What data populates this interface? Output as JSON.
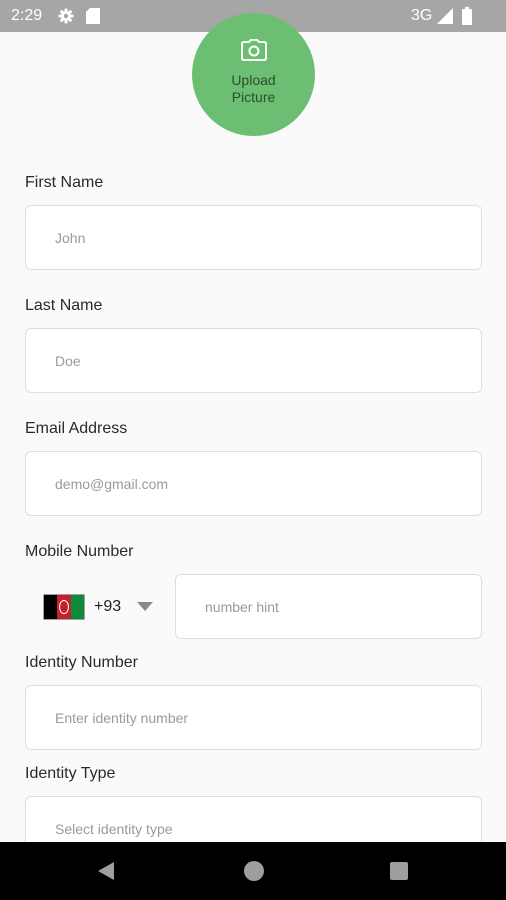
{
  "status_bar": {
    "time": "2:29",
    "network": "3G",
    "icons": [
      "gear-icon",
      "sd-card-icon",
      "signal-icon",
      "battery-icon"
    ]
  },
  "upload": {
    "line1": "Upload",
    "line2": "Picture",
    "icon": "camera-icon",
    "color": "#6cbf72"
  },
  "form": {
    "first_name": {
      "label": "First Name",
      "placeholder": "John"
    },
    "last_name": {
      "label": "Last Name",
      "placeholder": "Doe"
    },
    "email": {
      "label": "Email Address",
      "placeholder": "demo@gmail.com"
    },
    "mobile": {
      "label": "Mobile Number",
      "dial_code": "+93",
      "flag": "afghanistan-flag-icon",
      "placeholder": "number hint"
    },
    "identity_number": {
      "label": "Identity Number",
      "placeholder": "Enter identity number"
    },
    "identity_type": {
      "label": "Identity Type",
      "placeholder": "Select identity type"
    }
  },
  "nav_bar": {
    "icons": [
      "back-icon",
      "home-icon",
      "recents-icon"
    ]
  }
}
